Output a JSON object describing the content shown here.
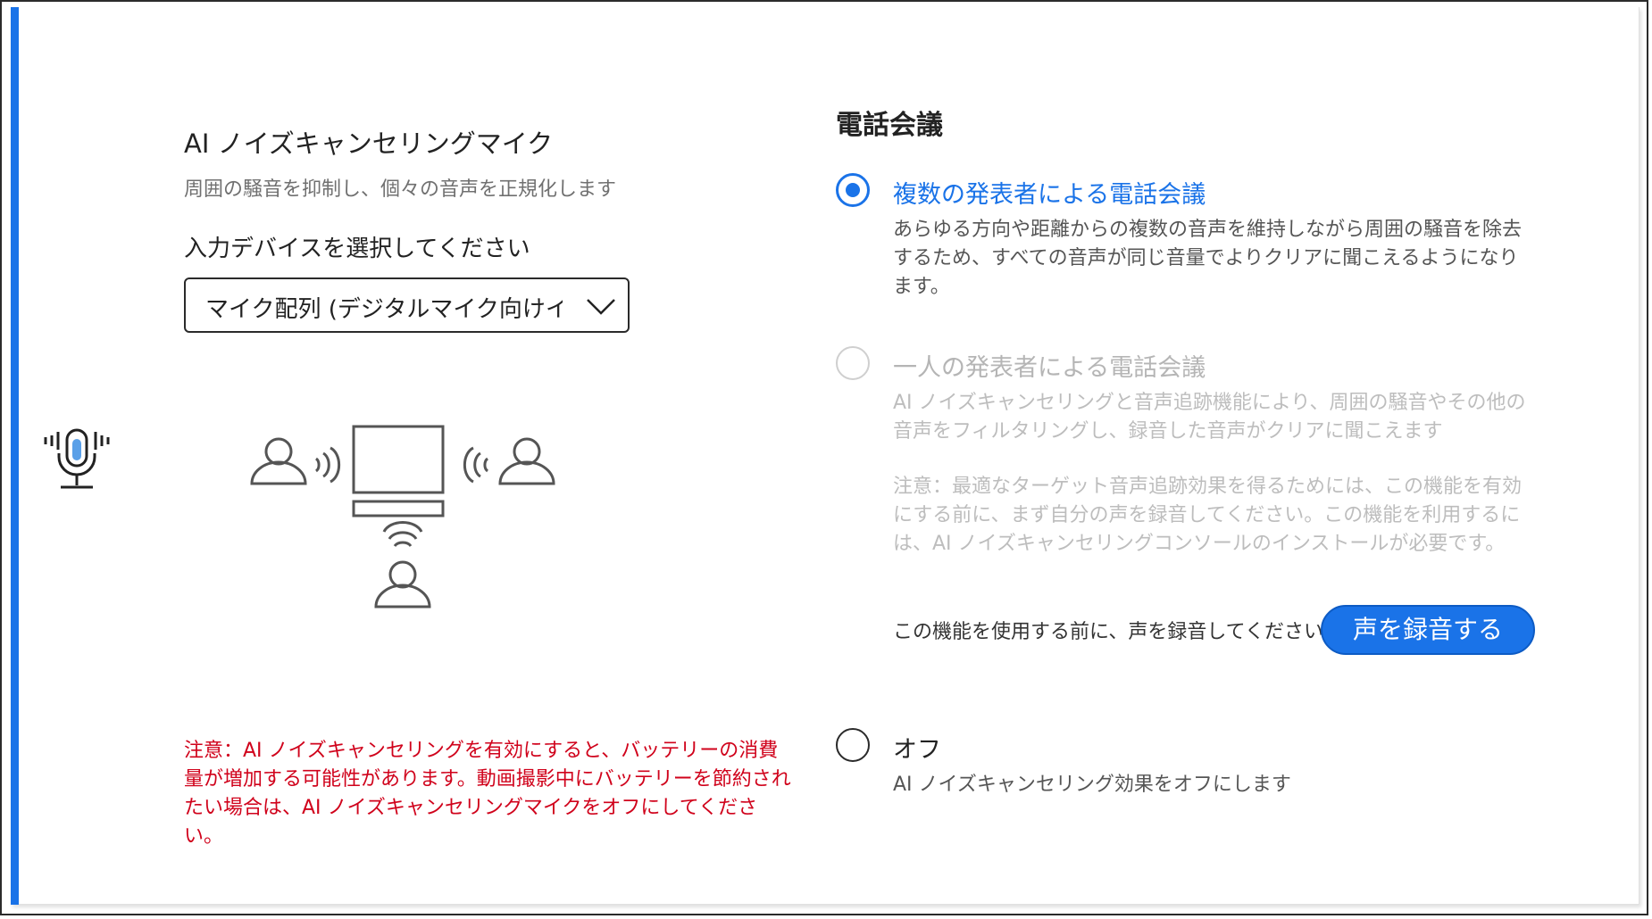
{
  "colors": {
    "accent": "#1a73e8",
    "warning": "#d0021b",
    "disabled": "#bdbdbd"
  },
  "left": {
    "title": "AI ノイズキャンセリングマイク",
    "description": "周囲の騒音を抑制し、個々の音声を正規化します",
    "select_label": "入力デバイスを選択してください",
    "select_value": "マイク配列 (デジタルマイク向けインテル",
    "warning": "注意：AI ノイズキャンセリングを有効にすると、バッテリーの消費量が増加する可能性があります。動画撮影中にバッテリーを節約されたい場合は、AI ノイズキャンセリングマイクをオフにしてください。"
  },
  "right": {
    "section_title": "電話会議",
    "options": [
      {
        "label": "複数の発表者による電話会議",
        "description": "あらゆる方向や距離からの複数の音声を維持しながら周囲の騒音を除去するため、すべての音声が同じ音量でよりクリアに聞こえるようになります。",
        "state": "selected"
      },
      {
        "label": "一人の発表者による電話会議",
        "description": "AI ノイズキャンセリングと音声追跡機能により、周囲の騒音やその他の音声をフィルタリングし、録音した音声がクリアに聞こえます",
        "note": "注意：最適なターゲット音声追跡効果を得るためには、この機能を有効にする前に、まず自分の声を録音してください。この機能を利用するには、AI ノイズキャンセリングコンソールのインストールが必要です。",
        "state": "disabled"
      },
      {
        "label": "オフ",
        "description": "AI ノイズキャンセリング効果をオフにします",
        "state": "unselected"
      }
    ],
    "record_hint": "この機能を使用する前に、声を録音してください",
    "record_button": "声を録音する"
  }
}
